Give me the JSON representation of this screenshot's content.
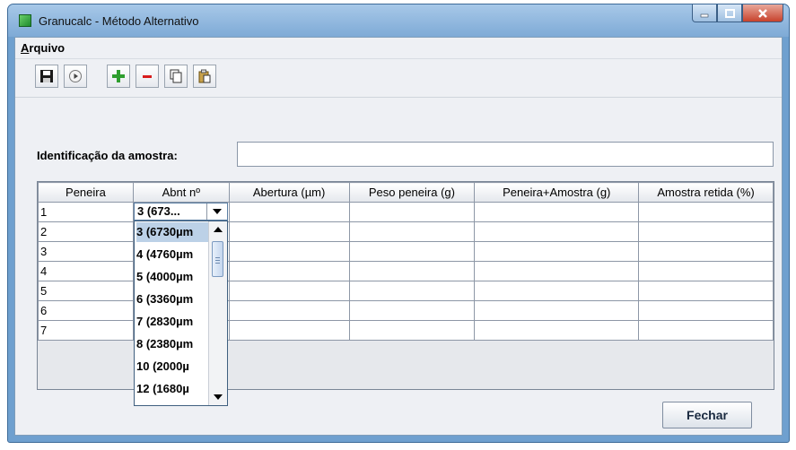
{
  "window": {
    "title": "Granucalc - Método Alternativo"
  },
  "menu": {
    "items": [
      {
        "label": "Arquivo"
      }
    ]
  },
  "form": {
    "id_label": "Identificação da amostra:",
    "id_value": ""
  },
  "table": {
    "columns": [
      "Peneira",
      "Abnt nº",
      "Abertura (µm)",
      "Peso peneira (g)",
      "Peneira+Amostra (g)",
      "Amostra retida (%)"
    ],
    "rows": [
      [
        "1",
        "",
        "",
        "",
        "",
        ""
      ],
      [
        "2",
        "",
        "",
        "",
        "",
        ""
      ],
      [
        "3",
        "",
        "",
        "",
        "",
        ""
      ],
      [
        "4",
        "",
        "",
        "",
        "",
        ""
      ],
      [
        "5",
        "",
        "",
        "",
        "",
        ""
      ],
      [
        "6",
        "",
        "",
        "",
        "",
        ""
      ],
      [
        "7",
        "",
        "",
        "",
        "",
        ""
      ]
    ]
  },
  "combo": {
    "value": "3 (673...",
    "options": [
      "3 (6730µm",
      "4 (4760µm",
      "5 (4000µm",
      "6 (3360µm",
      "7 (2830µm",
      "8 (2380µm",
      "10 (2000µ",
      "12 (1680µ"
    ],
    "selected_index": 0
  },
  "buttons": {
    "close": "Fechar"
  },
  "colors": {
    "titlebar": "#7eaad6",
    "selection": "#bcd1e7",
    "add_icon": "#2e9e2e",
    "remove_icon": "#d81c1c"
  }
}
